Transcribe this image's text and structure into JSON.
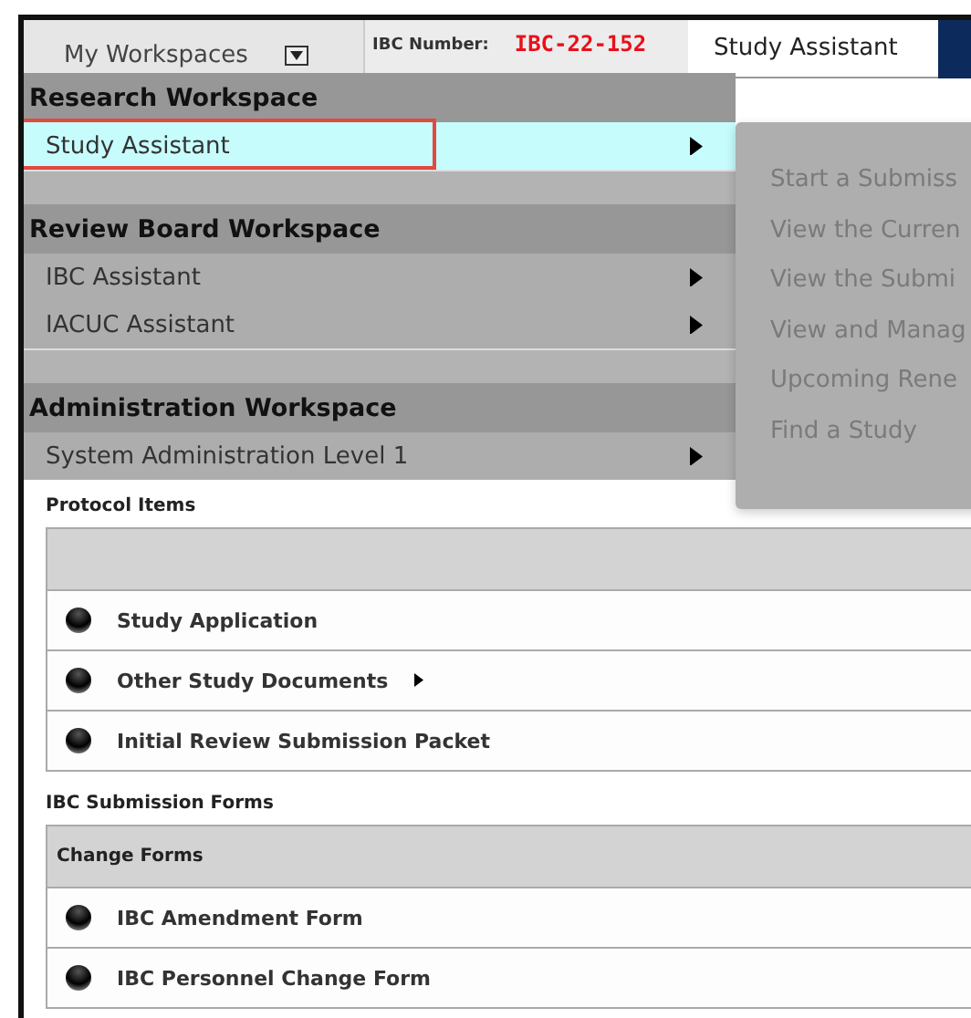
{
  "header": {
    "workspace_menu": {
      "label": "My Workspaces",
      "expanded": true
    },
    "ibc_number": {
      "label": "IBC Number:",
      "value": "IBC-22-152"
    },
    "tab": {
      "label": "Study Assistant",
      "selected": true
    }
  },
  "menu": {
    "groups": [
      {
        "title": "Research Workspace",
        "items": [
          {
            "label": "Study Assistant",
            "selected": true,
            "highlighted": true,
            "has_submenu": true
          }
        ]
      },
      {
        "title": "Review Board Workspace",
        "items": [
          {
            "label": "IBC Assistant",
            "selected": false,
            "highlighted": false,
            "has_submenu": true
          },
          {
            "label": "IACUC Assistant",
            "selected": false,
            "highlighted": false,
            "has_submenu": true
          }
        ]
      },
      {
        "title": "Administration Workspace",
        "items": [
          {
            "label": "System Administration Level 1",
            "selected": false,
            "highlighted": false,
            "has_submenu": true
          }
        ]
      }
    ]
  },
  "submenu": {
    "items": [
      {
        "label": "Start a Submiss",
        "disabled": true
      },
      {
        "label": "View the Curren",
        "disabled": true
      },
      {
        "label": "View the Submi",
        "disabled": true
      },
      {
        "label": "View and Manag",
        "disabled": true
      },
      {
        "label": "Upcoming Rene",
        "disabled": true
      },
      {
        "label": "Find a Study",
        "disabled": true
      }
    ]
  },
  "protocol_items": {
    "title": "Protocol Items",
    "items": [
      {
        "label": "Study Application",
        "has_submenu": false
      },
      {
        "label": "Other Study Documents",
        "has_submenu": true
      },
      {
        "label": "Initial Review Submission Packet",
        "has_submenu": false
      }
    ]
  },
  "submission_forms": {
    "title": "IBC Submission Forms",
    "group_title": "Change Forms",
    "items": [
      {
        "label": "IBC Amendment Form",
        "has_submenu": false
      },
      {
        "label": "IBC Personnel Change Form",
        "has_submenu": false
      }
    ]
  }
}
